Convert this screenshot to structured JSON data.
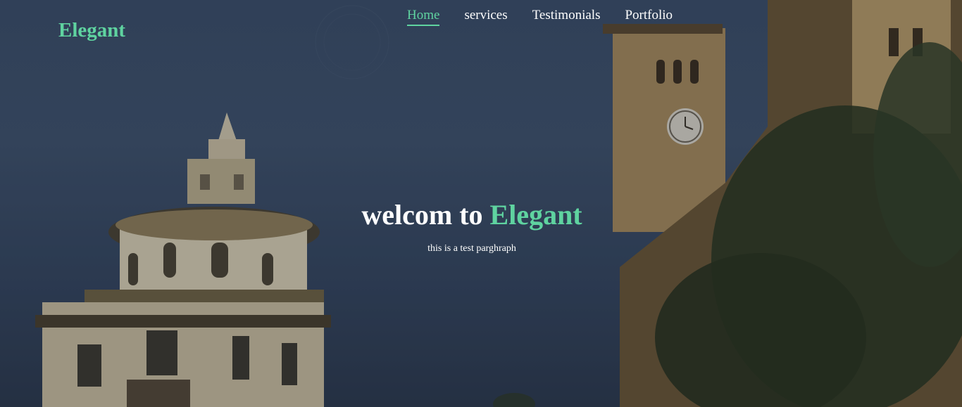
{
  "brand": {
    "name": "Elegant",
    "accent_color": "#5fd3a0"
  },
  "nav": {
    "items": [
      {
        "label": "Home",
        "active": true
      },
      {
        "label": "services",
        "active": false
      },
      {
        "label": "Testimonials",
        "active": false
      },
      {
        "label": "Portfolio",
        "active": false
      }
    ]
  },
  "hero": {
    "title_prefix": "welcom to",
    "title_accent": "Elegant",
    "subtitle": "this is a test parghraph",
    "background_image": "historic stone buildings with domed tower and clock tower against dusk sky"
  }
}
